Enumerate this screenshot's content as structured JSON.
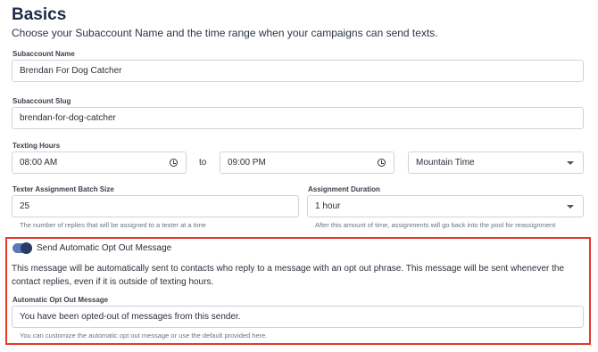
{
  "section": {
    "title": "Basics",
    "subtitle": "Choose your Subaccount Name and the time range when your campaigns can send texts."
  },
  "subaccount_name": {
    "label": "Subaccount Name",
    "value": "Brendan For Dog Catcher"
  },
  "subaccount_slug": {
    "label": "Subaccount Slug",
    "value": "brendan-for-dog-catcher"
  },
  "texting_hours": {
    "label": "Texting Hours",
    "start": "08:00 AM",
    "separator": "to",
    "end": "09:00 PM",
    "timezone": "Mountain Time"
  },
  "batch_size": {
    "label": "Texter Assignment Batch Size",
    "value": "25",
    "help": "The number of replies that will be assigned to a texter at a time"
  },
  "assignment_duration": {
    "label": "Assignment Duration",
    "value": "1 hour",
    "help": "After this amount of time, assignments will go back into the pool for reassignment"
  },
  "opt_out": {
    "toggle_on": true,
    "toggle_label": "Send Automatic Opt Out Message",
    "description": "This message will be automatically sent to contacts who reply to a message with an opt out phrase. This message will be sent whenever the contact replies, even if it is outside of texting hours.",
    "message_label": "Automatic Opt Out Message",
    "message_value": "You have been opted-out of messages from this sender.",
    "message_help": "You can customize the automatic opt out message or use the default provided here."
  },
  "colors": {
    "accent": "#2c3a66",
    "toggle_track": "#5b79b8",
    "highlight_border": "#e5392b"
  }
}
